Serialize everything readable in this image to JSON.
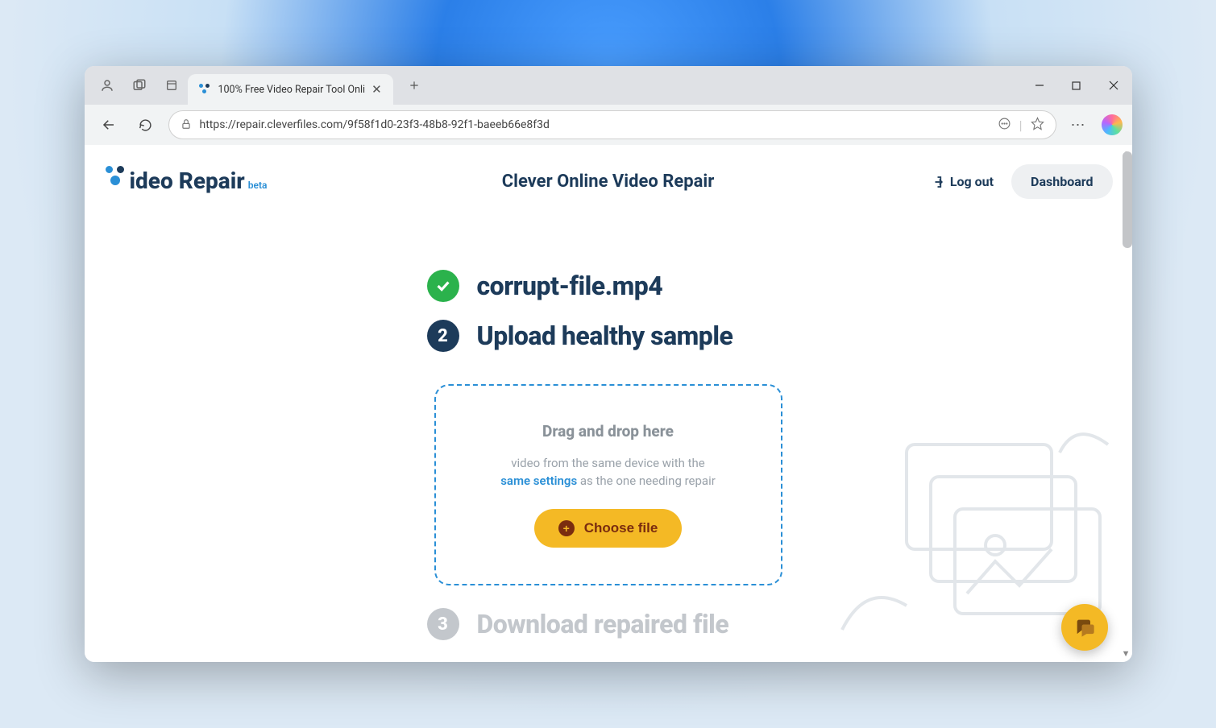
{
  "browser": {
    "tab_title": "100% Free Video Repair Tool Onli",
    "url": "https://repair.cleverfiles.com/9f58f1d0-23f3-48b8-92f1-baeeb66e8f3d"
  },
  "app": {
    "logo_text": "ideo Repair",
    "logo_badge": "beta",
    "title": "Clever Online Video Repair",
    "logout": "Log out",
    "dashboard": "Dashboard"
  },
  "steps": {
    "one_label": "corrupt-file.mp4",
    "two_number": "2",
    "two_label": "Upload healthy sample",
    "three_number": "3",
    "three_label": "Download repaired file"
  },
  "dropzone": {
    "title": "Drag and drop here",
    "sub_before": "video from the same device with the",
    "sub_link": "same settings",
    "sub_after": " as the one needing repair",
    "button": "Choose file"
  }
}
